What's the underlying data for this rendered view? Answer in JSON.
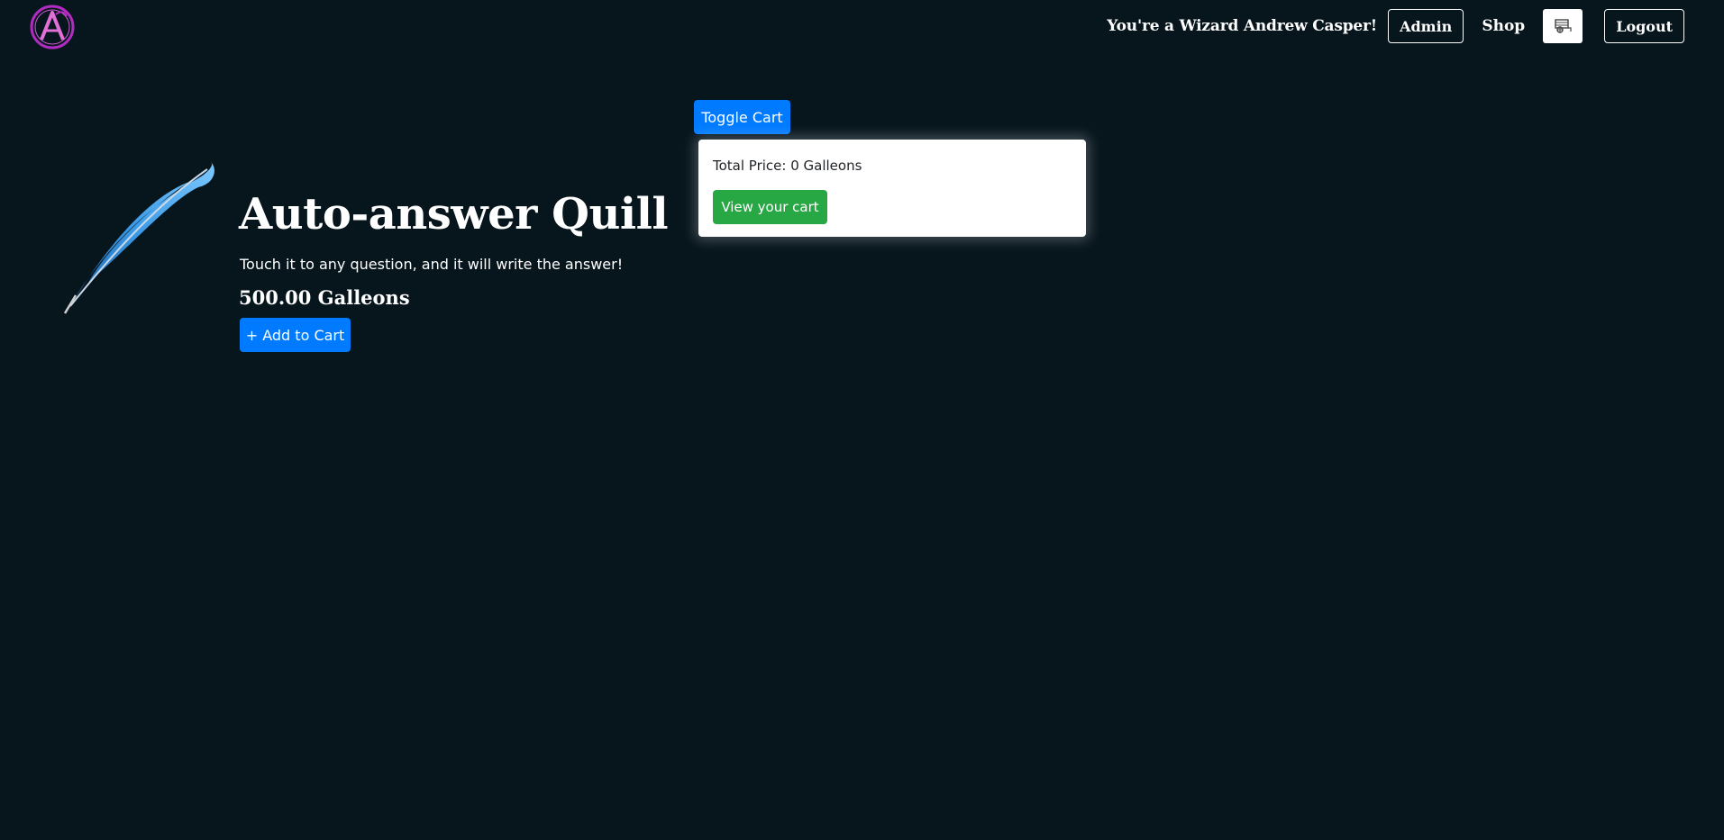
{
  "nav": {
    "logo_icon": "wizard-a-monogram-icon",
    "greeting": "You're a Wizard Andrew Casper!",
    "admin_label": "Admin",
    "shop_label": "Shop",
    "cart_icon": "cart-icon",
    "logout_label": "Logout"
  },
  "cart": {
    "toggle_label": "Toggle Cart",
    "total_price": "Total Price: 0 Galleons",
    "view_label": "View your cart"
  },
  "product": {
    "image_icon": "blue-feather-quill-icon",
    "title": "Auto-answer Quill",
    "description": "Touch it to any question, and it will write the answer!",
    "price": "500.00 Galleons",
    "add_label": "+ Add to Cart"
  },
  "colors": {
    "background": "#07151d",
    "primary": "#007bff",
    "success": "#28a745",
    "logo_purple": "#b02cc0"
  }
}
